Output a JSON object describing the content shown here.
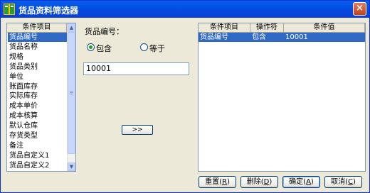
{
  "window": {
    "title": "货品资料筛选器",
    "close_label": "×"
  },
  "left_list": {
    "header": "条件项目",
    "items": [
      "货品编号",
      "货品名称",
      "规格",
      "货品类别",
      "单位",
      "账面库存",
      "实际库存",
      "成本单价",
      "成本核算",
      "默认仓库",
      "存货类型",
      "备注",
      "货品自定义1",
      "货品自定义2"
    ],
    "selected_index": 0
  },
  "scrollbar": {
    "up": "▲",
    "down": "▼"
  },
  "middle": {
    "field_label": "货品编号：",
    "radio_contains": "包含",
    "radio_equals": "等于",
    "selected_radio": "包含",
    "value": "10001",
    "add_button": ">>"
  },
  "right_table": {
    "columns": [
      "条件项目",
      "操作符",
      "条件值"
    ],
    "rows": [
      [
        "货品编号",
        "包含",
        "10001"
      ]
    ]
  },
  "buttons": {
    "reset": {
      "text": "重置(",
      "key": "R",
      "end": ")"
    },
    "delete": {
      "text": "删除(",
      "key": "D",
      "end": ")"
    },
    "ok": {
      "text": "确定(",
      "key": "A",
      "end": ")"
    },
    "cancel": {
      "text": "取消(",
      "key": "C",
      "end": ")"
    }
  },
  "colors": {
    "titlebar": "#0054E3",
    "selection": "#316AC5",
    "face": "#ECE9D8",
    "radio_dot": "#21A121"
  }
}
